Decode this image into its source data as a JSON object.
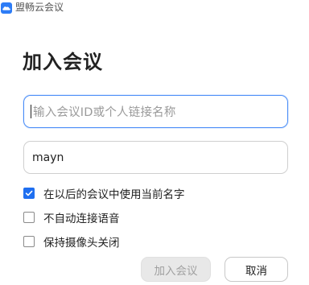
{
  "window": {
    "title": "盟畅云会议"
  },
  "heading": "加入会议",
  "meeting_id_input": {
    "placeholder": "输入会议ID或个人链接名称",
    "value": ""
  },
  "name_input": {
    "value": "mayn"
  },
  "options": [
    {
      "label": "在以后的会议中使用当前名字",
      "checked": true
    },
    {
      "label": "不自动连接语音",
      "checked": false
    },
    {
      "label": "保持摄像头关闭",
      "checked": false
    }
  ],
  "buttons": {
    "join_label": "加入会议",
    "cancel_label": "取消"
  },
  "colors": {
    "accent": "#1f6ff0",
    "focus_border": "#4a8df7",
    "disabled_button_bg": "#e8e8e8",
    "disabled_button_text": "#a0a0a0"
  },
  "icons": {
    "app_icon": "cloud-app-icon",
    "check_icon": "checkmark-icon"
  }
}
